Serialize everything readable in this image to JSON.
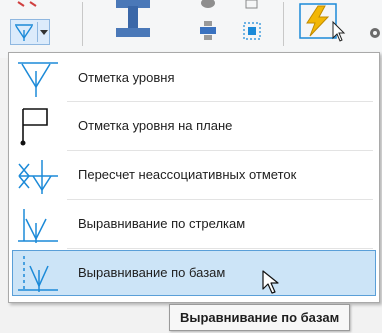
{
  "menu": {
    "items": [
      {
        "label": "Отметка уровня",
        "icon": "level-mark-icon",
        "highlighted": false
      },
      {
        "label": "Отметка уровня на плане",
        "icon": "plan-level-mark-icon",
        "highlighted": false
      },
      {
        "label": "Пересчет неассоциативных отметок",
        "icon": "recalc-marks-icon",
        "highlighted": false
      },
      {
        "label": "Выравнивание по стрелкам",
        "icon": "align-arrows-icon",
        "highlighted": false
      },
      {
        "label": "Выравнивание по базам",
        "icon": "align-bases-icon",
        "highlighted": true
      }
    ]
  },
  "tooltip": {
    "text": "Выравнивание по базам"
  },
  "colors": {
    "accent": "#1c8ad8",
    "highlight_bg": "#cce4f7",
    "highlight_border": "#5a9fd8",
    "lightning": "#f2b705",
    "cross": "#1c8ad8"
  }
}
